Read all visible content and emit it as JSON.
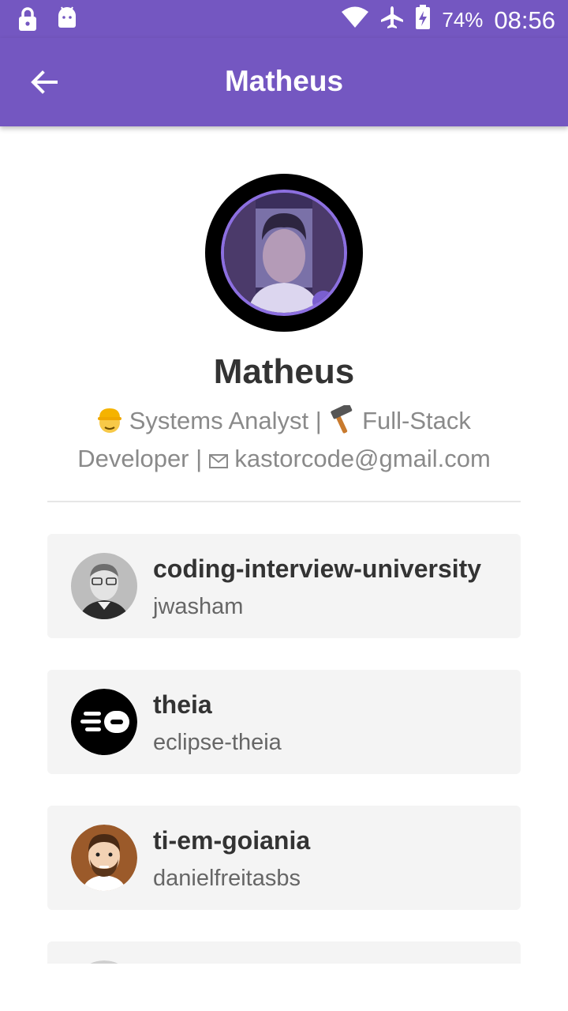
{
  "status_bar": {
    "battery": "74%",
    "time": "08:56",
    "icons": [
      "lock-icon",
      "android-icon",
      "wifi-icon",
      "airplane-icon",
      "battery-icon"
    ]
  },
  "app_bar": {
    "title": "Matheus",
    "back_icon": "arrow-left-icon"
  },
  "profile": {
    "name": "Matheus",
    "bio_part1": "Systems Analyst | ",
    "bio_part2": "Full-Stack Developer | ",
    "bio_email": "kastorcode@gmail.com",
    "bio_icons": [
      "construction-worker-emoji",
      "hammer-emoji",
      "envelope-icon"
    ]
  },
  "repos": [
    {
      "name": "coding-interview-university",
      "owner": "jwasham",
      "avatar_icon": "person-photo"
    },
    {
      "name": "theia",
      "owner": "eclipse-theia",
      "avatar_icon": "theia-logo"
    },
    {
      "name": "ti-em-goiania",
      "owner": "danielfreitasbs",
      "avatar_icon": "cartoon-avatar"
    },
    {
      "name": "",
      "owner": "",
      "avatar_icon": "person-photo"
    }
  ],
  "colors": {
    "primary": "#7457c1",
    "card_bg": "#f4f4f4",
    "text_dark": "#333333",
    "text_muted": "#8a8a8a"
  }
}
